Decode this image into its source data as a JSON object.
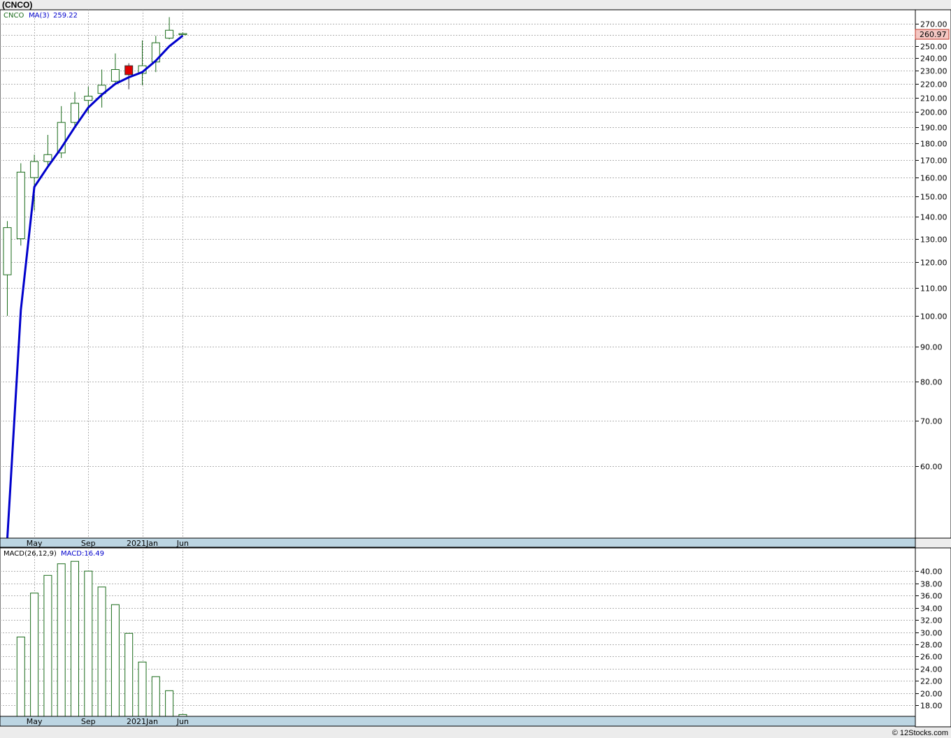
{
  "header": {
    "title": "(CNCO)"
  },
  "footer": {
    "credit": "© 12Stocks.com"
  },
  "colors": {
    "up": "#1a6b1a",
    "down": "#e00000",
    "ma": "#0000cc",
    "band": "#bcd5e2",
    "grid": "#b0b0b0"
  },
  "chart_data": [
    {
      "type": "candlestick",
      "legend": {
        "symbol": "CNCO",
        "ma_label": "MA(3)",
        "ma_value": "259.22"
      },
      "last_price": "260.97",
      "scale": "log",
      "ylim": [
        47,
        283
      ],
      "yticks": [
        60,
        70,
        80,
        90,
        100,
        110,
        120,
        130,
        140,
        150,
        160,
        170,
        180,
        190,
        200,
        210,
        220,
        230,
        240,
        250,
        260,
        270
      ],
      "ytick_labels": [
        "60.00",
        "70.00",
        "80.00",
        "90.00",
        "100.00",
        "110.00",
        "120.00",
        "130.00",
        "140.00",
        "150.00",
        "160.00",
        "170.00",
        "180.00",
        "190.00",
        "200.00",
        "210.00",
        "220.00",
        "230.00",
        "240.00",
        "250.00",
        "260.00",
        "270.00"
      ],
      "x_labels": [
        {
          "i": 2,
          "label": "May"
        },
        {
          "i": 6,
          "label": "Sep"
        },
        {
          "i": 10,
          "label": "2021Jan"
        },
        {
          "i": 13,
          "label": "Jun"
        }
      ],
      "candles": [
        {
          "o": 115,
          "h": 138,
          "l": 100,
          "c": 135
        },
        {
          "o": 130,
          "h": 168,
          "l": 127,
          "c": 163
        },
        {
          "o": 160,
          "h": 173,
          "l": 143,
          "c": 169
        },
        {
          "o": 169,
          "h": 185,
          "l": 166,
          "c": 173
        },
        {
          "o": 174,
          "h": 204,
          "l": 171,
          "c": 193
        },
        {
          "o": 193,
          "h": 214,
          "l": 190,
          "c": 206
        },
        {
          "o": 208,
          "h": 218,
          "l": 199,
          "c": 211
        },
        {
          "o": 213,
          "h": 231,
          "l": 203,
          "c": 219
        },
        {
          "o": 222,
          "h": 244,
          "l": 219,
          "c": 231
        },
        {
          "o": 234,
          "h": 236,
          "l": 216,
          "c": 227
        },
        {
          "o": 228,
          "h": 255,
          "l": 219,
          "c": 234
        },
        {
          "o": 237,
          "h": 259,
          "l": 229,
          "c": 253
        },
        {
          "o": 257,
          "h": 276,
          "l": 256,
          "c": 264
        },
        {
          "o": 261,
          "h": 262,
          "l": 260,
          "c": 261
        }
      ],
      "ma": [
        47,
        102,
        155,
        166,
        177,
        190,
        203,
        212,
        220,
        225,
        229,
        238,
        250,
        259.22
      ]
    },
    {
      "type": "bar",
      "legend": {
        "label": "MACD(26,12,9)",
        "value": "MACD:16.49"
      },
      "ylim": [
        16.2,
        43.8
      ],
      "yticks": [
        18,
        20,
        22,
        24,
        26,
        28,
        30,
        32,
        34,
        36,
        38,
        40
      ],
      "ytick_labels": [
        "18.00",
        "20.00",
        "22.00",
        "24.00",
        "26.00",
        "28.00",
        "30.00",
        "32.00",
        "34.00",
        "36.00",
        "38.00",
        "40.00"
      ],
      "x_labels": [
        {
          "i": 2,
          "label": "May"
        },
        {
          "i": 6,
          "label": "Sep"
        },
        {
          "i": 10,
          "label": "2021Jan"
        },
        {
          "i": 13,
          "label": "Jun"
        }
      ],
      "values": [
        null,
        29.2,
        36.4,
        39.3,
        41.2,
        41.6,
        40.0,
        37.4,
        34.5,
        29.8,
        25.1,
        22.7,
        20.4,
        16.5
      ]
    }
  ]
}
